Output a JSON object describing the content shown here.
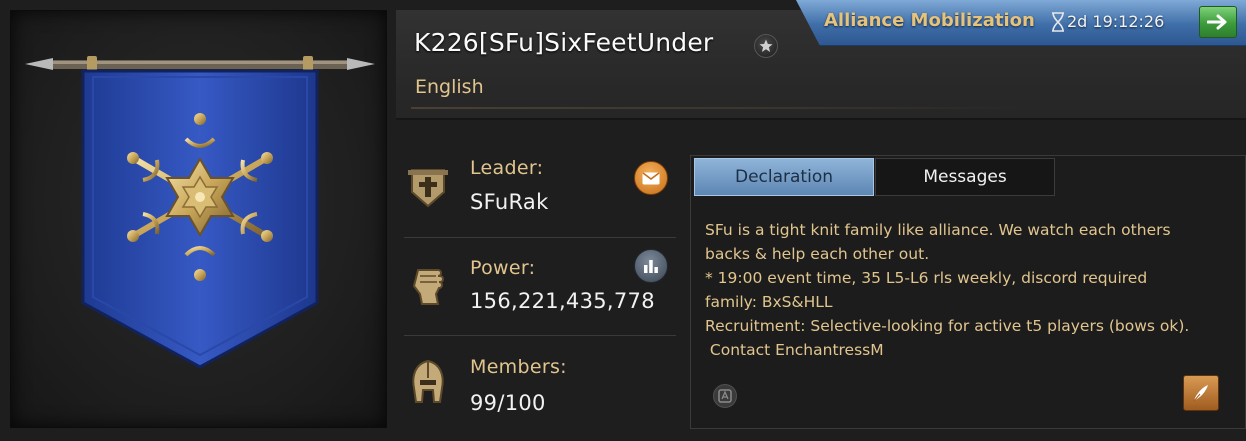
{
  "alliance": {
    "name": "K226[SFu]SixFeetUnder",
    "language": "English"
  },
  "mobilization": {
    "title": "Alliance Mobilization",
    "timer": "2d 19:12:26"
  },
  "info": {
    "leader_label": "Leader:",
    "leader_value": "SFuRak",
    "power_label": "Power:",
    "power_value": "156,221,435,778",
    "members_label": "Members:",
    "members_value": "99/100"
  },
  "tabs": {
    "declaration": "Declaration",
    "messages": "Messages"
  },
  "declaration": {
    "lines": [
      "SFu is a tight knit family like alliance. We watch each others",
      "backs & help each other out.",
      "* 19:00 event time, 35 L5-L6 rls weekly, discord required",
      "family: BxS&HLL",
      "Recruitment: Selective-looking for active t5 players (bows ok).",
      " Contact EnchantressM"
    ]
  },
  "colors": {
    "gold_text": "#e1c58e",
    "banner_blue": "#2f4fb0",
    "mobilization_blue": "#3f6ea8",
    "go_green": "#3c9c3b"
  },
  "icons": {
    "banner_emblem": "snowflake-emblem",
    "leader": "leader-crest-icon",
    "power": "fist-icon",
    "members": "helmet-icon"
  }
}
